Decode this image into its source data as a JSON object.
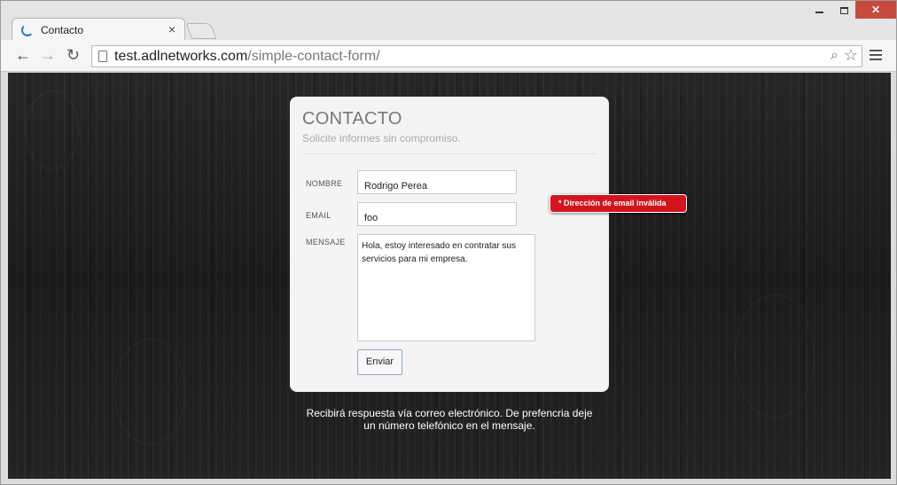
{
  "browser": {
    "tab_title": "Contacto",
    "tab_close": "×",
    "url_host": "test.adlnetworks.com",
    "url_path": "/simple-contact-form/"
  },
  "page": {
    "card": {
      "title": "CONTACTO",
      "subtitle": "Solicite informes sin compromiso."
    },
    "form": {
      "name_label": "NOMBRE",
      "name_value": "Rodrigo Perea",
      "email_label": "EMAIL",
      "email_value": "foo",
      "message_label": "MENSAJE",
      "message_value": "Hola, estoy interesado en contratar sus servicios para mi empresa.",
      "submit_label": "Enviar"
    },
    "error_message": "* Dirección de email inválida",
    "footer_line1": "Recibirá respuesta vía correo electrónico. De prefencria deje",
    "footer_line2": "un número telefónico en el mensaje."
  },
  "icons": {
    "back": "arrow-left",
    "forward": "arrow-right",
    "reload": "reload",
    "zoom": "magnifier",
    "bookmark": "star",
    "menu": "hamburger"
  },
  "colors": {
    "error": "#d4141c",
    "loading_spinner": "#2d7bd6",
    "close_button": "#c84a3e"
  }
}
